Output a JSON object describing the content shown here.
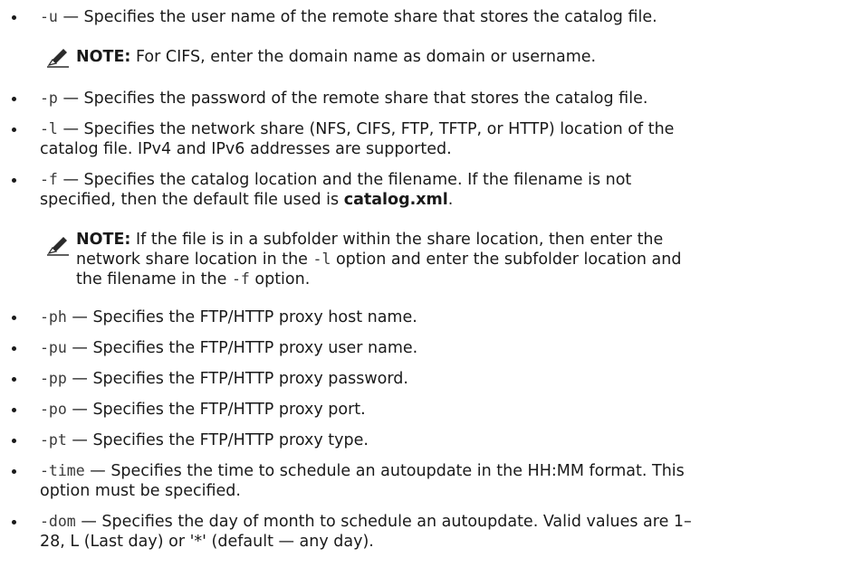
{
  "separator": " — ",
  "items": [
    {
      "opt": "-u",
      "text": "Specifies the user name of the remote share that stores the catalog file."
    },
    {
      "opt": "-p",
      "text": "Specifies the password of the remote share that stores the catalog file."
    },
    {
      "opt": "-l",
      "text_l1": "Specifies the network share (NFS, CIFS, FTP, TFTP, or HTTP) location of the",
      "text_l2": "catalog file. IPv4 and IPv6 addresses are supported."
    },
    {
      "opt": "-f",
      "text_l1": "Specifies the catalog location and the filename. If the filename is not",
      "text_l2_a": "specified, then the default file used is ",
      "text_l2_bold": "catalog.xml",
      "text_l2_end": "."
    },
    {
      "opt": "-ph",
      "text": "Specifies the FTP/HTTP proxy host name."
    },
    {
      "opt": "-pu",
      "text": "Specifies the FTP/HTTP proxy user name."
    },
    {
      "opt": "-pp",
      "text": "Specifies the FTP/HTTP proxy password."
    },
    {
      "opt": "-po",
      "text": "Specifies the FTP/HTTP proxy port."
    },
    {
      "opt": "-pt",
      "text": "Specifies the FTP/HTTP proxy type."
    },
    {
      "opt": "-time",
      "text_l1": "Specifies the time to schedule an autoupdate in the HH:MM format. This",
      "text_l2": "option must be specified."
    },
    {
      "opt": "-dom",
      "text_l1": "Specifies the day of month to schedule an autoupdate. Valid values are 1–",
      "text_l2": "28, L (Last day) or '*' (default — any day)."
    }
  ],
  "notes": [
    {
      "label": "NOTE:",
      "text": " For CIFS, enter the domain name as domain or username."
    },
    {
      "label": "NOTE:",
      "l1": " If the file is in a subfolder within the share location, then enter the",
      "l2_a": "network share location in the ",
      "l2_code": "-l",
      "l2_b": " option and enter the subfolder location and",
      "l3_a": "the filename in the ",
      "l3_code": "-f",
      "l3_b": " option."
    }
  ]
}
